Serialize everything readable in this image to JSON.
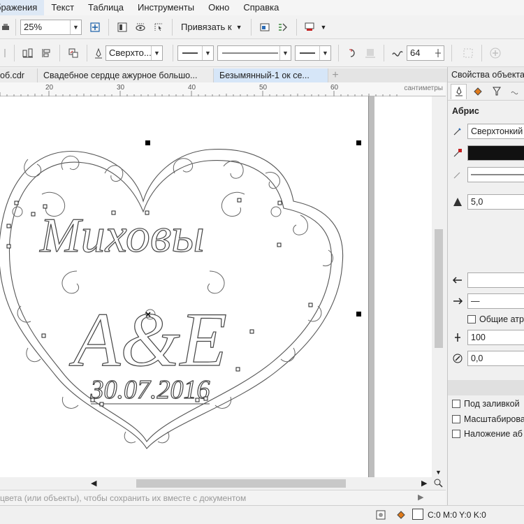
{
  "menu": [
    "бражения",
    "Текст",
    "Таблица",
    "Инструменты",
    "Окно",
    "Справка"
  ],
  "toolbar1": {
    "zoom_value": "25%",
    "snap_label": "Привязать к"
  },
  "toolbar2": {
    "outline_width": "Сверхто...",
    "smoothing_value": "64"
  },
  "tabs": [
    {
      "label": "об.cdr",
      "active": false
    },
    {
      "label": "Свадебное сердце ажурное большо...",
      "active": false
    },
    {
      "label": "Безымянный-1 ок се...",
      "active": true
    }
  ],
  "ruler": {
    "labels": [
      "20",
      "30",
      "40",
      "50",
      "60"
    ],
    "unit": "сантиметры"
  },
  "artwork": {
    "name_text": "Миховы",
    "initials_text": "А&Е",
    "date_text": "30.07.2016"
  },
  "panel": {
    "title": "Свойства объекта",
    "section": "Абрис",
    "outline_width": "Сверхтонкий",
    "outline_color": "#111111",
    "miter_value": "5,0",
    "end_arrow": "—",
    "shared_attr_label": "Общие атр",
    "stretch_value": "100",
    "angle_value": "0,0",
    "check_behind_fill": "Под заливкой",
    "check_scale": "Масштабирова",
    "check_overprint": "Наложение аб"
  },
  "palette_hint": "цвета (или объекты), чтобы сохранить их вместе с документом",
  "status": {
    "color_readout": "C:0 M:0 Y:0 K:0"
  }
}
